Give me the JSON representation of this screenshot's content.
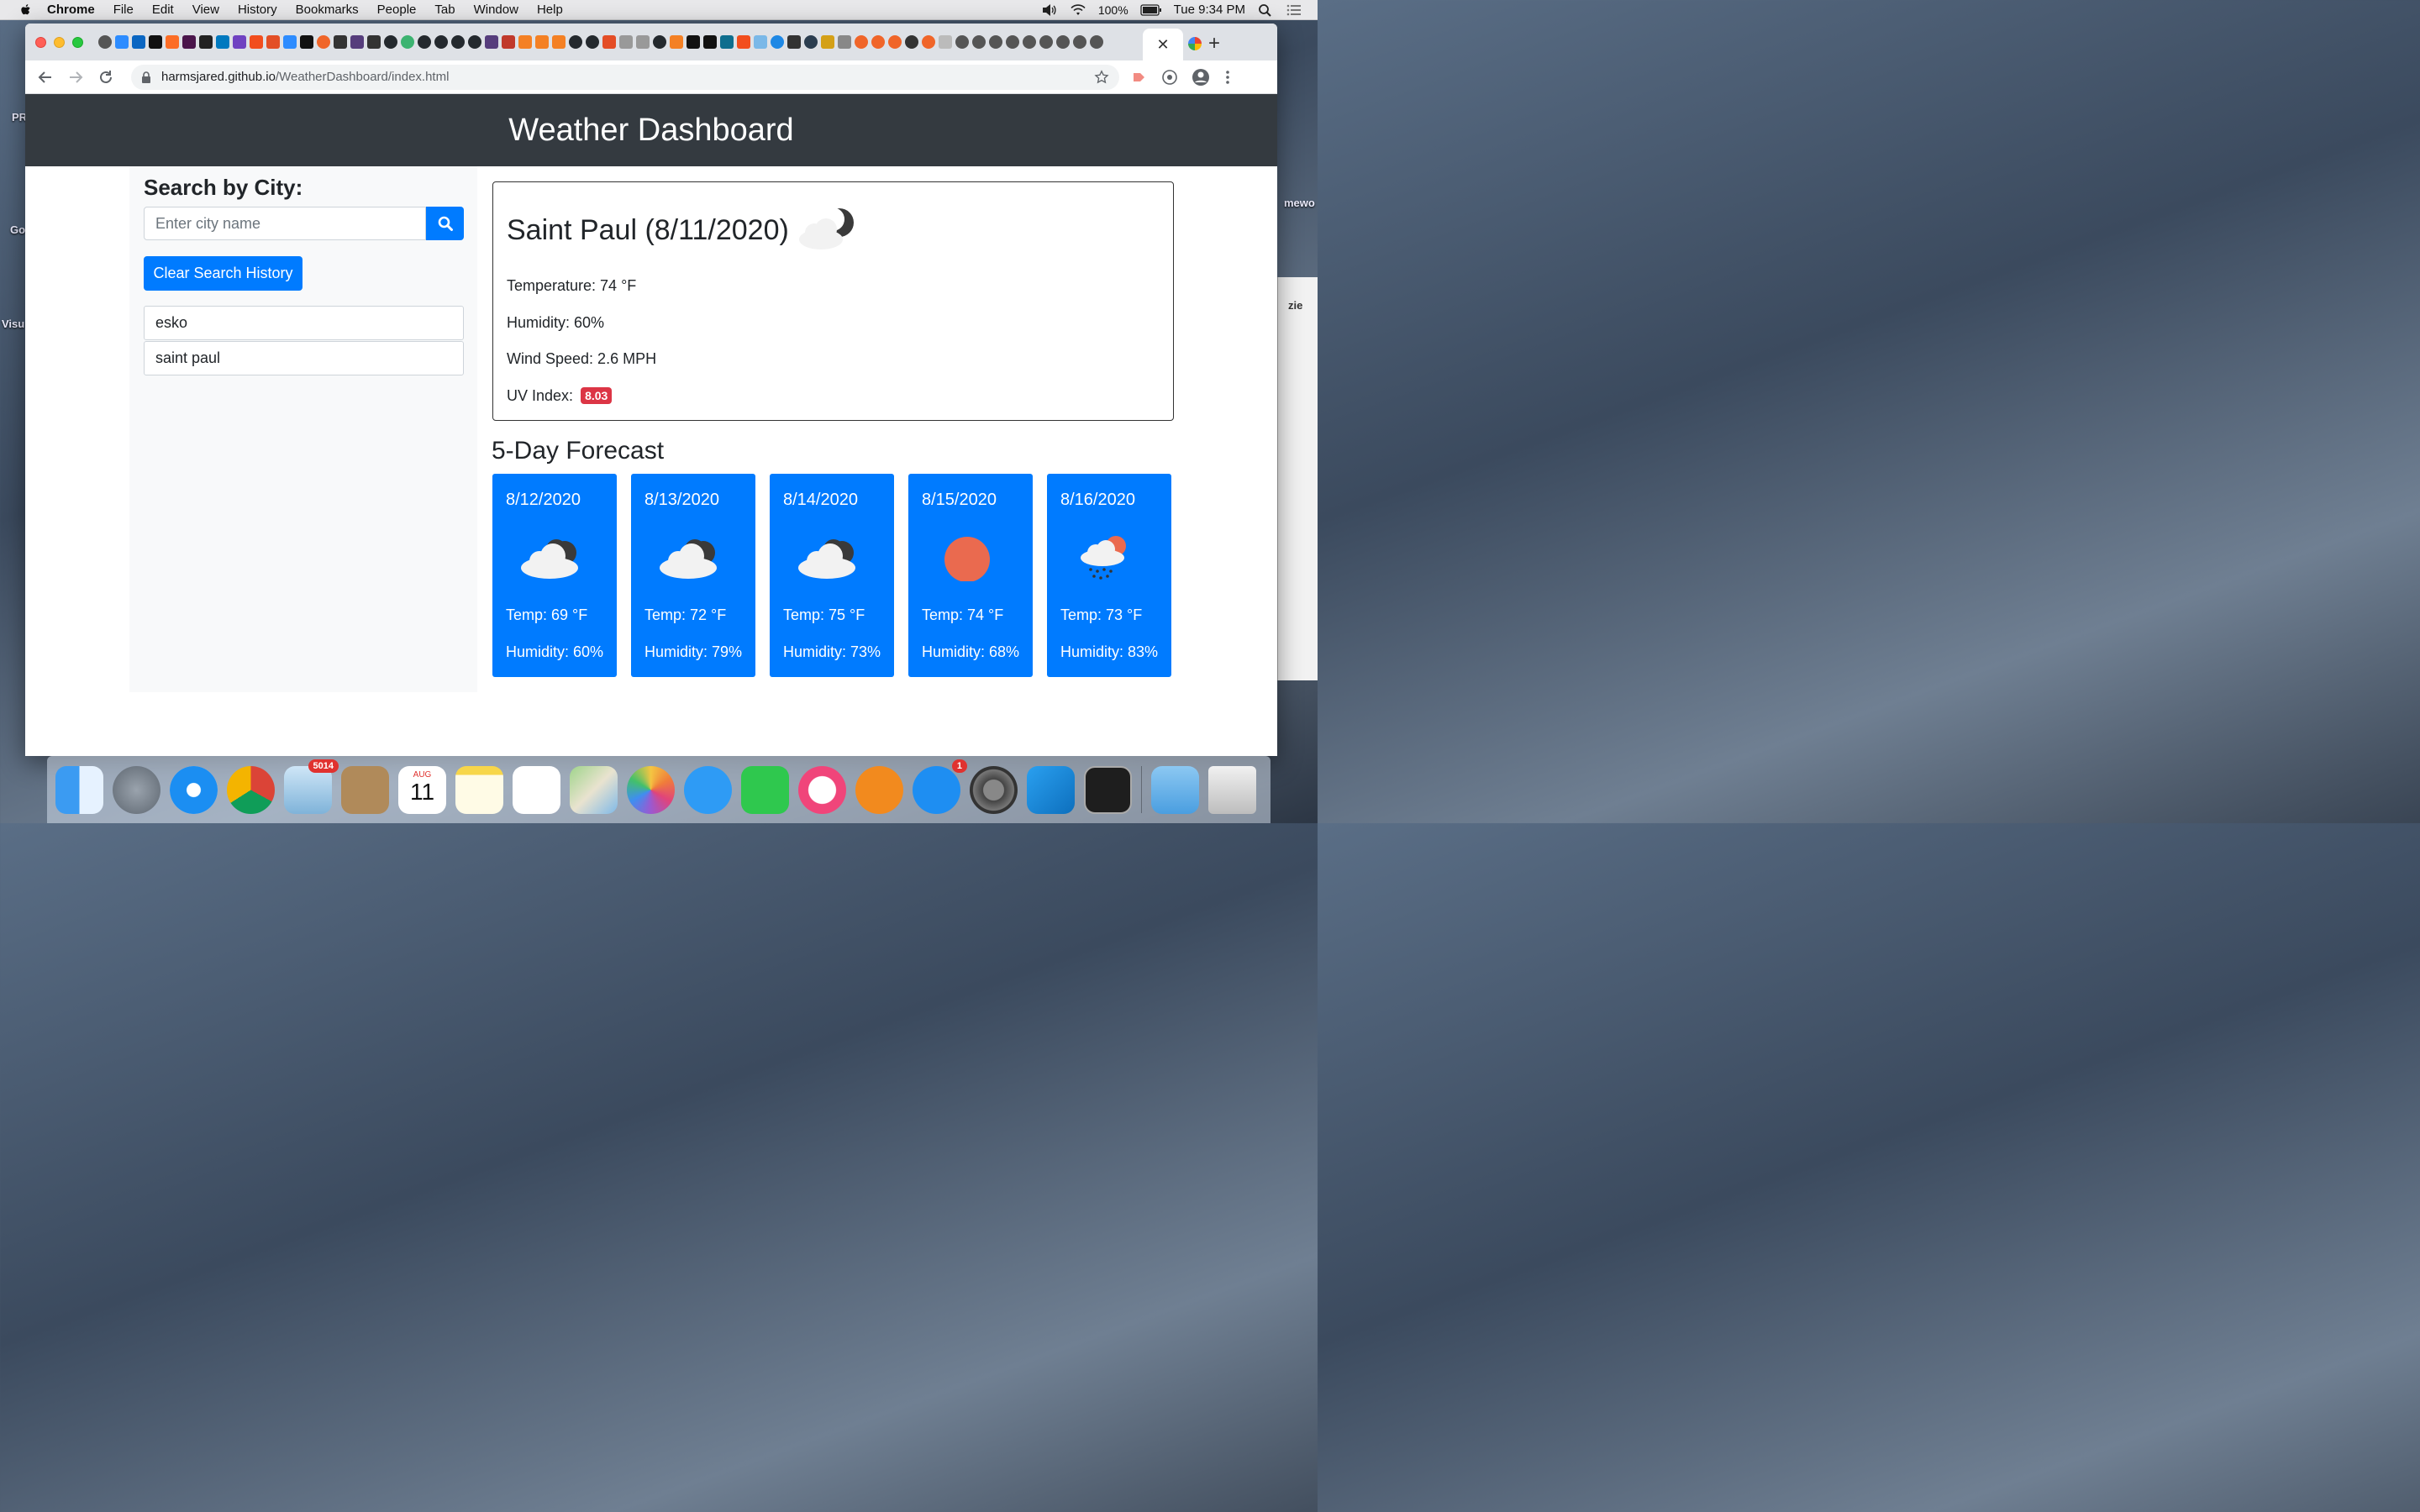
{
  "menubar": {
    "app_name": "Chrome",
    "items": [
      "File",
      "Edit",
      "View",
      "History",
      "Bookmarks",
      "People",
      "Tab",
      "Window",
      "Help"
    ],
    "battery": "100%",
    "clock": "Tue 9:34 PM"
  },
  "desktop": {
    "labels": [
      "PR",
      "Go",
      "Visu",
      "mewo",
      "zie"
    ]
  },
  "browser": {
    "url_host": "harmsjared.github.io",
    "url_path": "/WeatherDashboard/index.html",
    "close_tab_glyph": "✕",
    "new_tab_glyph": "+"
  },
  "page": {
    "title": "Weather Dashboard",
    "sidebar": {
      "heading": "Search by City:",
      "search_placeholder": "Enter city name",
      "clear_label": "Clear Search History",
      "history": [
        "esko",
        "saint paul"
      ]
    },
    "current": {
      "city_date": "Saint Paul (8/11/2020)",
      "icon": "cloud-moon-icon",
      "temperature": "Temperature: 74 °F",
      "humidity": "Humidity: 60%",
      "wind": "Wind Speed: 2.6 MPH",
      "uv_label": "UV Index:",
      "uv_value": "8.03",
      "uv_color": "#dc3545"
    },
    "forecast_title": "5-Day Forecast",
    "forecast": [
      {
        "date": "8/12/2020",
        "icon": "cloud-moon-icon",
        "temp": "Temp: 69 °F",
        "humidity": "Humidity: 60%"
      },
      {
        "date": "8/13/2020",
        "icon": "cloud-moon-icon",
        "temp": "Temp: 72 °F",
        "humidity": "Humidity: 79%"
      },
      {
        "date": "8/14/2020",
        "icon": "cloud-moon-icon",
        "temp": "Temp: 75 °F",
        "humidity": "Humidity: 73%"
      },
      {
        "date": "8/15/2020",
        "icon": "sun-icon",
        "temp": "Temp: 74 °F",
        "humidity": "Humidity: 68%"
      },
      {
        "date": "8/16/2020",
        "icon": "rain-sun-icon",
        "temp": "Temp: 73 °F",
        "humidity": "Humidity: 83%"
      }
    ],
    "accent_color": "#007bff",
    "header_color": "#343a40"
  },
  "dock": {
    "apps": [
      {
        "name": "finder-icon"
      },
      {
        "name": "launchpad-icon"
      },
      {
        "name": "safari-icon"
      },
      {
        "name": "chrome-icon"
      },
      {
        "name": "mail-icon",
        "badge": "5014"
      },
      {
        "name": "contacts-icon"
      },
      {
        "name": "calendar-icon",
        "month": "AUG",
        "day": "11"
      },
      {
        "name": "notes-icon"
      },
      {
        "name": "reminders-icon"
      },
      {
        "name": "maps-icon"
      },
      {
        "name": "photos-icon"
      },
      {
        "name": "messages-icon"
      },
      {
        "name": "facetime-icon"
      },
      {
        "name": "itunes-icon"
      },
      {
        "name": "books-icon"
      },
      {
        "name": "app-store-icon",
        "badge": "1"
      },
      {
        "name": "system-preferences-icon"
      },
      {
        "name": "vscode-icon"
      },
      {
        "name": "terminal-icon"
      },
      {
        "name": "downloads-folder-icon"
      },
      {
        "name": "trash-icon"
      }
    ]
  }
}
